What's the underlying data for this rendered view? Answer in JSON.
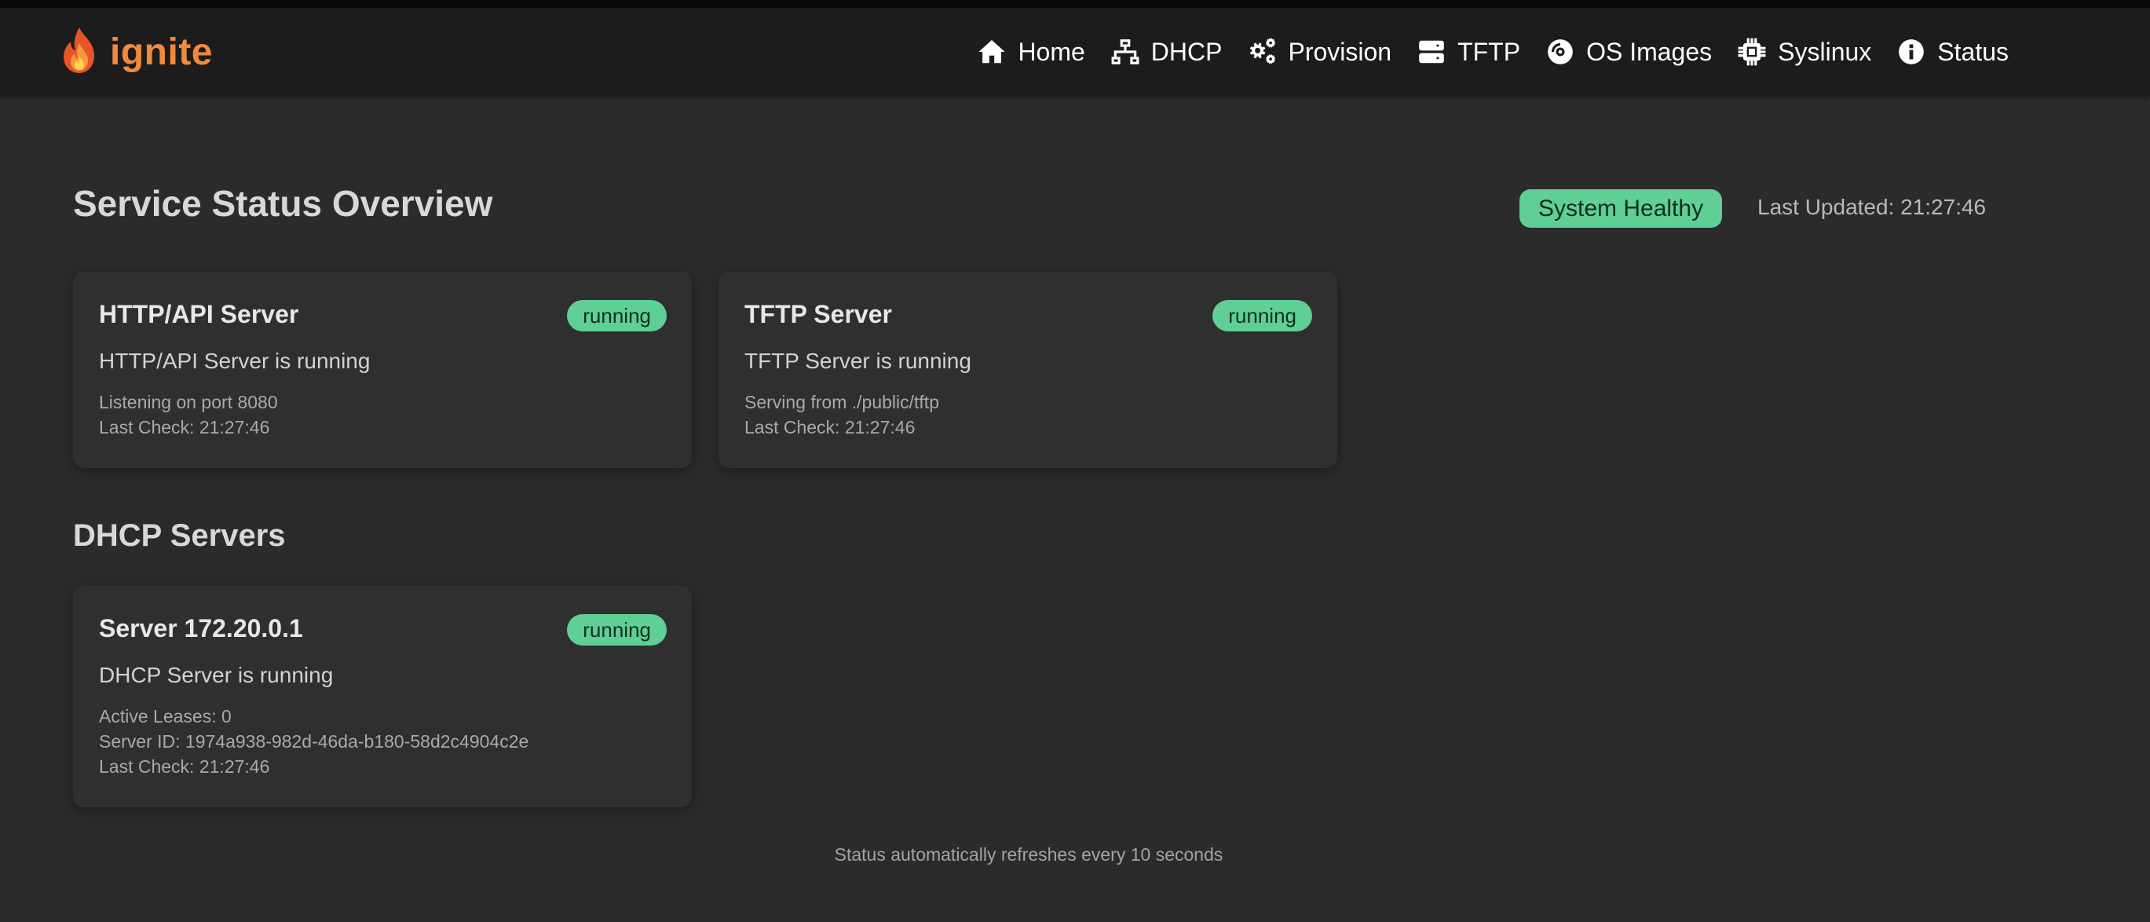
{
  "brand": {
    "name": "ignite"
  },
  "nav": {
    "items": [
      {
        "label": "Home",
        "icon": "home-icon"
      },
      {
        "label": "DHCP",
        "icon": "network-icon"
      },
      {
        "label": "Provision",
        "icon": "gears-icon"
      },
      {
        "label": "TFTP",
        "icon": "server-icon"
      },
      {
        "label": "OS Images",
        "icon": "disc-icon"
      },
      {
        "label": "Syslinux",
        "icon": "chip-icon"
      },
      {
        "label": "Status",
        "icon": "info-icon"
      }
    ]
  },
  "overview": {
    "title": "Service Status Overview",
    "health": "System Healthy",
    "last_updated": "Last Updated: 21:27:46"
  },
  "services": [
    {
      "name": "HTTP/API Server",
      "status": "running",
      "message": "HTTP/API Server is running",
      "details": [
        "Listening on port 8080",
        "Last Check: 21:27:46"
      ]
    },
    {
      "name": "TFTP Server",
      "status": "running",
      "message": "TFTP Server is running",
      "details": [
        "Serving from ./public/tftp",
        "Last Check: 21:27:46"
      ]
    }
  ],
  "dhcp": {
    "title": "DHCP Servers",
    "servers": [
      {
        "name": "Server 172.20.0.1",
        "status": "running",
        "message": "DHCP Server is running",
        "details": [
          "Active Leases: 0",
          "Server ID: 1974a938-982d-46da-b180-58d2c4904c2e",
          "Last Check: 21:27:46"
        ]
      }
    ]
  },
  "footer": {
    "note": "Status automatically refreshes every 10 seconds"
  },
  "colors": {
    "accent": "#f08a3c",
    "success": "#5fcf96",
    "background": "#2b2b2b",
    "navbar": "#1c1c1c"
  }
}
